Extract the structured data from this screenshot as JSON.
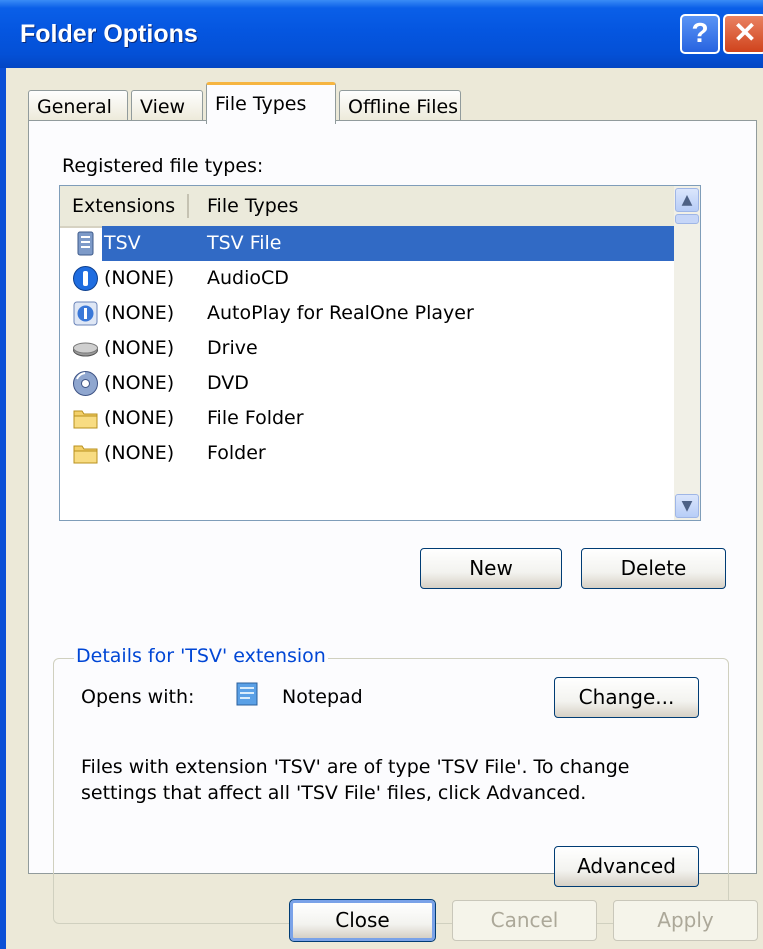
{
  "window": {
    "title": "Folder Options",
    "help_glyph": "?",
    "close_glyph": "✕"
  },
  "tabs": [
    {
      "label": "General",
      "active": false
    },
    {
      "label": "View",
      "active": false
    },
    {
      "label": "File Types",
      "active": true
    },
    {
      "label": "Offline Files",
      "active": false
    }
  ],
  "registered_label": "Registered file types:",
  "list": {
    "columns": [
      "Extensions",
      "File Types"
    ],
    "rows": [
      {
        "ext": "TSV",
        "type": "TSV File",
        "icon": "document-icon",
        "selected": true
      },
      {
        "ext": "(NONE)",
        "type": "AudioCD",
        "icon": "audiocd-icon",
        "selected": false
      },
      {
        "ext": "(NONE)",
        "type": "AutoPlay for RealOne Player",
        "icon": "autoplay-icon",
        "selected": false
      },
      {
        "ext": "(NONE)",
        "type": "Drive",
        "icon": "drive-icon",
        "selected": false
      },
      {
        "ext": "(NONE)",
        "type": "DVD",
        "icon": "dvd-icon",
        "selected": false
      },
      {
        "ext": "(NONE)",
        "type": "File Folder",
        "icon": "folder-icon",
        "selected": false
      },
      {
        "ext": "(NONE)",
        "type": "Folder",
        "icon": "folder-icon",
        "selected": false
      }
    ]
  },
  "buttons": {
    "new": "New",
    "delete": "Delete",
    "change": "Change...",
    "advanced": "Advanced",
    "close": "Close",
    "cancel": "Cancel",
    "apply": "Apply"
  },
  "details": {
    "legend": "Details for 'TSV' extension",
    "opens_with_label": "Opens with:",
    "opens_with_value": "Notepad",
    "description": "Files with extension 'TSV' are of type 'TSV File'.  To change settings that affect all 'TSV File' files, click Advanced."
  },
  "colors": {
    "selection": "#316ac5",
    "titlebar": "#0556e0",
    "legend_text": "#0046d5"
  }
}
